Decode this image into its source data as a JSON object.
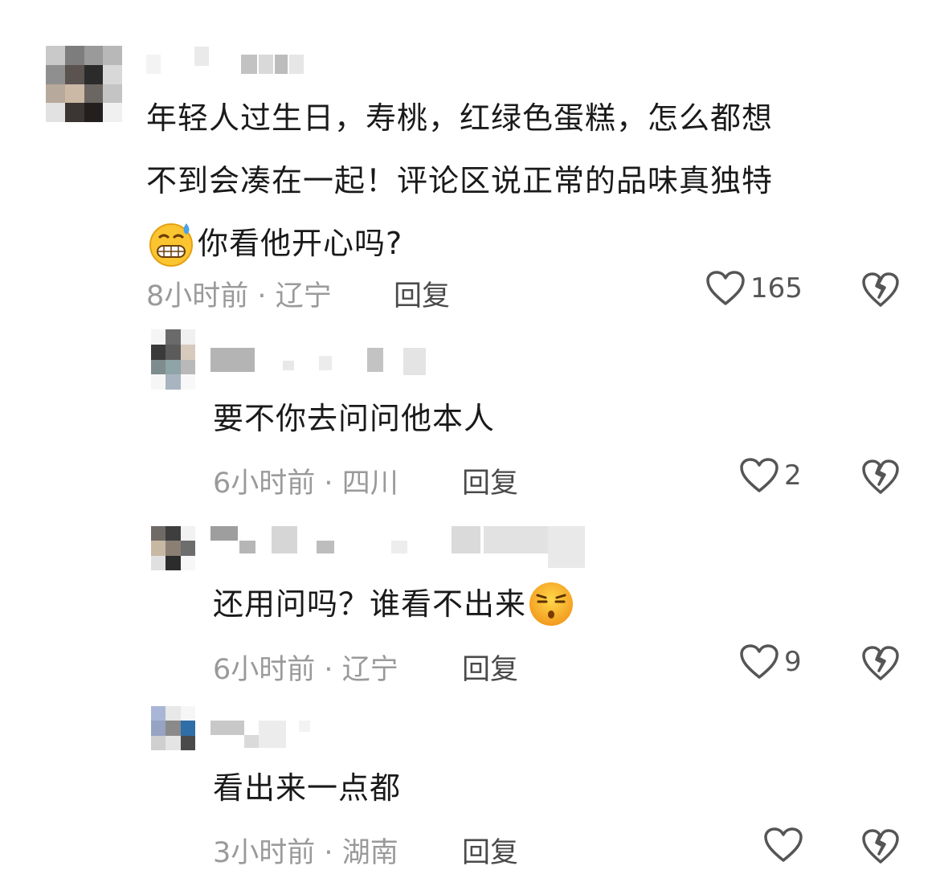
{
  "comments": [
    {
      "text_line1": "年轻人过生日，寿桃，红绿色蛋糕，怎么都想",
      "text_line2": "不到会凑在一起！评论区说正常的品味真独特",
      "text_line3": "你看他开心吗?",
      "emoji": "grimace-sweat-emoji",
      "time": "8小时前",
      "location": "辽宁",
      "reply_label": "回复",
      "likes": "165"
    },
    {
      "text": "要不你去问问他本人",
      "time": "6小时前",
      "location": "四川",
      "reply_label": "回复",
      "likes": "2"
    },
    {
      "text": "还用问吗？谁看不出来",
      "emoji": "smirk-face-emoji",
      "time": "6小时前",
      "location": "辽宁",
      "reply_label": "回复",
      "likes": "9"
    },
    {
      "text": "看出来一点都",
      "time": "3小时前",
      "location": "湖南",
      "reply_label": "回复",
      "likes": ""
    }
  ],
  "separator": "·",
  "colors": {
    "meta": "#9a9a9a",
    "icon": "#555555"
  }
}
